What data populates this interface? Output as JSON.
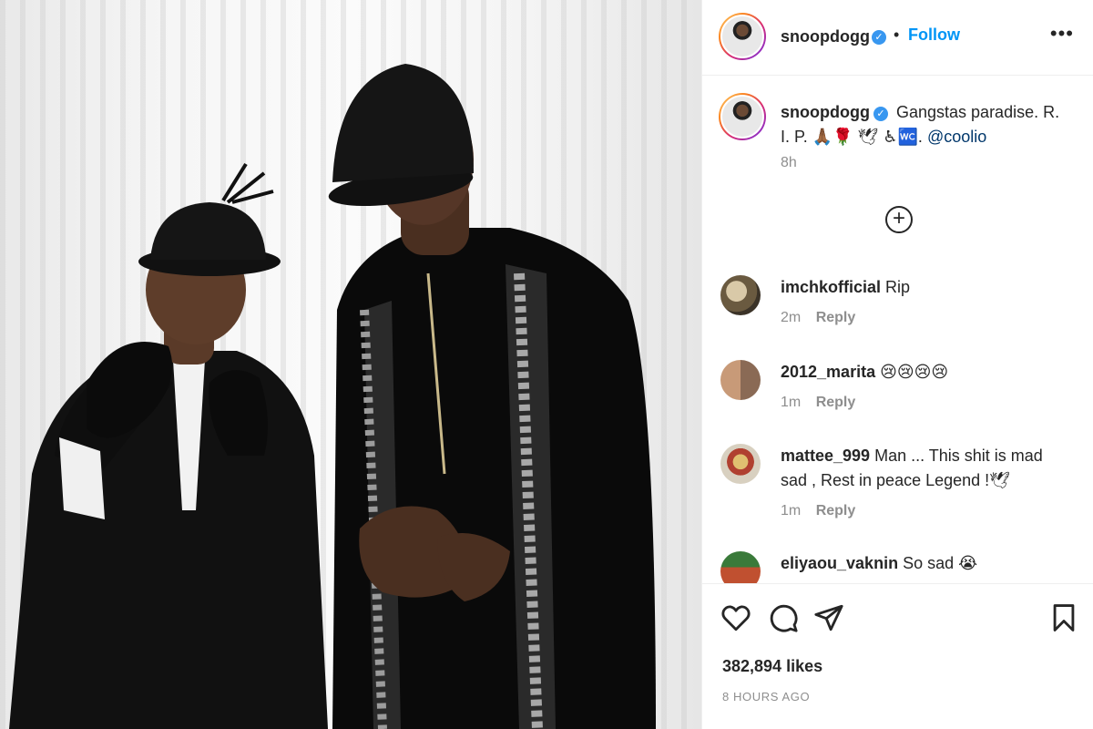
{
  "post": {
    "photo_description_icon": "photo-icon",
    "username": "snoopdogg",
    "verified_mark": "✓",
    "separator": "•",
    "follow_label": "Follow",
    "more_label": "•••",
    "caption_text": "Gangstas paradise. R. I. P. 🙏🏾🌹 🕊 ♿🚾.",
    "caption_mention": "@coolio",
    "caption_time": "8h",
    "load_more_label": "+"
  },
  "comments": [
    {
      "username": "imchkofficial",
      "text": "Rip",
      "time": "2m",
      "reply_label": "Reply"
    },
    {
      "username": "2012_marita",
      "text": "😢😢😢😢",
      "time": "1m",
      "reply_label": "Reply"
    },
    {
      "username": "mattee_999",
      "text": "Man ... This shit is mad sad , Rest in peace Legend !🕊",
      "time": "1m",
      "reply_label": "Reply"
    },
    {
      "username": "eliyaou_vaknin",
      "text": "So sad 😭",
      "time": "",
      "reply_label": ""
    }
  ],
  "actions": {
    "like_icon": "heart-icon",
    "comment_icon": "comment-icon",
    "share_icon": "share-icon",
    "save_icon": "bookmark-icon",
    "likes": "382,894 likes",
    "timestamp": "8 HOURS AGO"
  },
  "colors": {
    "accent_blue": "#0095f6",
    "mention": "#00376b",
    "muted": "#8e8e8e",
    "text": "#262626"
  }
}
